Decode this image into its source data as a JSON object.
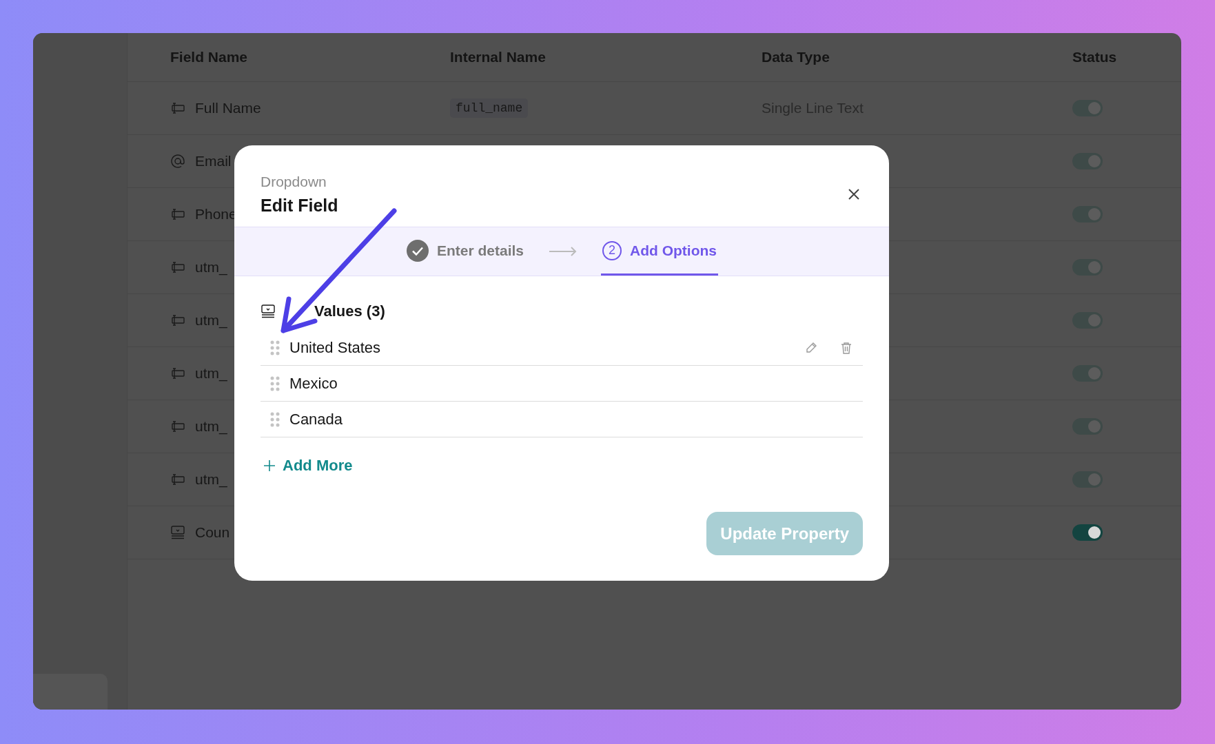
{
  "table": {
    "columns": [
      "Field Name",
      "Internal Name",
      "Data Type",
      "Status"
    ],
    "rows": [
      {
        "kind": "text",
        "field_name": "Full Name",
        "internal_name": "full_name",
        "data_type": "Single Line Text",
        "on": true,
        "disabled": true
      },
      {
        "kind": "email",
        "field_name": "Email",
        "on": true,
        "disabled": true
      },
      {
        "kind": "text",
        "field_name": "Phone",
        "on": true,
        "disabled": true
      },
      {
        "kind": "text",
        "field_name": "utm_",
        "on": true,
        "disabled": true
      },
      {
        "kind": "text",
        "field_name": "utm_",
        "on": true,
        "disabled": true
      },
      {
        "kind": "text",
        "field_name": "utm_",
        "on": true,
        "disabled": true
      },
      {
        "kind": "text",
        "field_name": "utm_",
        "on": true,
        "disabled": true
      },
      {
        "kind": "text",
        "field_name": "utm_",
        "on": true,
        "disabled": true
      },
      {
        "kind": "dropdown",
        "field_name": "Coun",
        "on": true,
        "disabled": false
      }
    ]
  },
  "modal": {
    "subtitle": "Dropdown",
    "title": "Edit Field",
    "steps": [
      {
        "label": "Enter details",
        "done": true,
        "selected": false
      },
      {
        "number": "2",
        "label": "Add Options",
        "done": false,
        "selected": true
      }
    ],
    "values_heading": "Values (3)",
    "values": [
      {
        "label": "United States",
        "hovered": true
      },
      {
        "label": "Mexico",
        "hovered": false
      },
      {
        "label": "Canada",
        "hovered": false
      }
    ],
    "add_more": "Add More",
    "submit": {
      "label": "Update Property",
      "disabled": true
    }
  }
}
